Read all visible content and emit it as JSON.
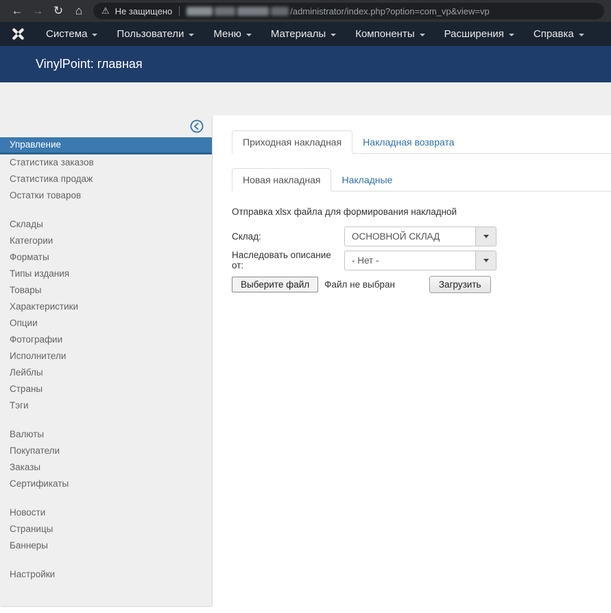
{
  "browser": {
    "security_label": "Не защищено",
    "url_path": "/administrator/index.php?option=com_vp&view=vp"
  },
  "menubar": {
    "items": [
      "Система",
      "Пользователи",
      "Меню",
      "Материалы",
      "Компоненты",
      "Расширения",
      "Справка"
    ]
  },
  "header": {
    "title": "VinylPoint: главная"
  },
  "sidebar": {
    "active_item": "Управление",
    "group1": [
      "Статистика заказов",
      "Статистика продаж",
      "Остатки товаров"
    ],
    "group2": [
      "Склады",
      "Категории",
      "Форматы",
      "Типы издания",
      "Товары",
      "Характеристики",
      "Опции",
      "Фотографии",
      "Исполнители",
      "Лейблы",
      "Страны",
      "Тэги"
    ],
    "group3": [
      "Валюты",
      "Покупатели",
      "Заказы",
      "Сертификаты"
    ],
    "group4": [
      "Новости",
      "Страницы",
      "Баннеры"
    ],
    "group5": [
      "Настройки"
    ]
  },
  "main": {
    "tabs": [
      {
        "label": "Приходная накладная",
        "active": true
      },
      {
        "label": "Накладная возврата",
        "active": false
      }
    ],
    "subtabs": [
      {
        "label": "Новая накладная",
        "active": true
      },
      {
        "label": "Накладные",
        "active": false
      }
    ],
    "form": {
      "description": "Отправка xlsx файла для формирования накладной",
      "warehouse_label": "Склад:",
      "warehouse_value": "ОСНОВНОЙ СКЛАД",
      "inherit_label": "Наследовать описание от:",
      "inherit_value": "- Нет -",
      "file_button": "Выберите файл",
      "file_status": "Файл не выбран",
      "upload_button": "Загрузить"
    }
  },
  "colors": {
    "header_blue": "#1e3d6b",
    "menubar_dark": "#1a2430",
    "link_blue": "#3071a9",
    "sidebar_active_bg": "#3b79b0",
    "sidebar_bg": "#efefef"
  }
}
